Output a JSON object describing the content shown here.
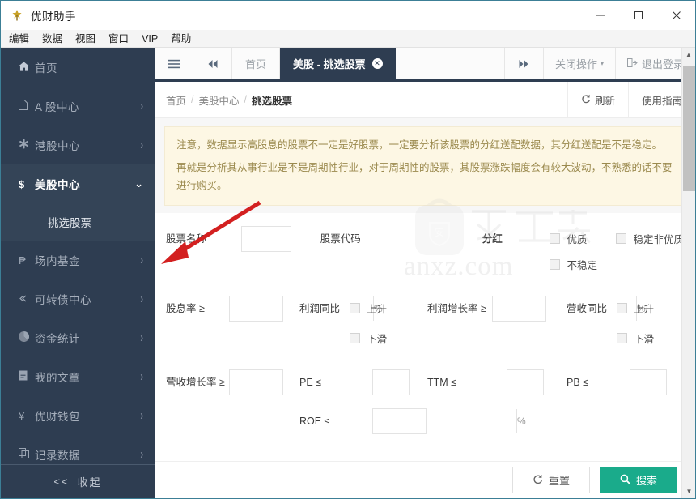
{
  "window": {
    "title": "优财助手",
    "app_icon": "app-logo-icon",
    "controls": {
      "minimize": "−",
      "maximize": "□",
      "close": "✕"
    }
  },
  "menubar": {
    "items": [
      "编辑",
      "数据",
      "视图",
      "窗口",
      "VIP",
      "帮助"
    ]
  },
  "sidebar": {
    "items": [
      {
        "label": "首页",
        "icon": "home-icon",
        "chevron": "",
        "active": false
      },
      {
        "label": "A 股中心",
        "icon": "file-icon",
        "chevron": "›",
        "active": false
      },
      {
        "label": "港股中心",
        "icon": "asterisk-icon",
        "chevron": "›",
        "active": false
      },
      {
        "label": "美股中心",
        "icon": "dollar-icon",
        "chevron": "⌄",
        "active": true
      },
      {
        "label": "场内基金",
        "icon": "peso-icon",
        "chevron": "›",
        "active": false
      },
      {
        "label": "可转债中心",
        "icon": "link-icon",
        "chevron": "›",
        "active": false
      },
      {
        "label": "资金统计",
        "icon": "pie-chart-icon",
        "chevron": "›",
        "active": false
      },
      {
        "label": "我的文章",
        "icon": "document-icon",
        "chevron": "›",
        "active": false
      },
      {
        "label": "优财钱包",
        "icon": "yen-icon",
        "chevron": "›",
        "active": false
      },
      {
        "label": "记录数据",
        "icon": "copy-icon",
        "chevron": "›",
        "active": false
      }
    ],
    "submenu": {
      "label": "挑选股票",
      "selected": true
    },
    "collapse": {
      "arrows": "<<",
      "label": "收起"
    }
  },
  "tabstrip": {
    "menu_icon": "hamburger-icon",
    "prev_icon": "double-chevron-left-icon",
    "next_icon": "double-chevron-right-icon",
    "tabs": [
      {
        "label": "首页",
        "active": false,
        "closable": false
      },
      {
        "label": "美股 - 挑选股票",
        "active": true,
        "closable": true
      }
    ],
    "close_ops": {
      "label": "关闭操作",
      "caret": "▾"
    },
    "logout": {
      "label": "退出登录",
      "icon": "logout-icon"
    }
  },
  "breadcrumb": {
    "items": [
      "首页",
      "美股中心",
      "挑选股票"
    ],
    "separator": "/",
    "refresh": {
      "label": "刷新",
      "icon": "refresh-icon"
    },
    "guide": {
      "label": "使用指南"
    }
  },
  "notice": {
    "line1": "注意，数据显示高股息的股票不一定是好股票，一定要分析该股票的分红送配数据，其分红送配是不是稳定。",
    "line2": "再就是分析其从事行业是不是周期性行业，对于周期性的股票，其股票涨跌幅度会有较大波动，不熟悉的话不要进行购买。",
    "bg_color": "#fdf7e4",
    "text_color": "#9b8a4e"
  },
  "watermark": {
    "text": "anxz.com",
    "logo": "shield-bag-logo"
  },
  "form": {
    "row1": {
      "stock_name": {
        "label": "股票名称",
        "value": "",
        "placeholder": ""
      },
      "stock_code": {
        "label": "股票代码",
        "value": "",
        "placeholder": ""
      },
      "dividend": {
        "label": "分红"
      },
      "checkboxes": [
        {
          "label": "优质",
          "checked": false
        },
        {
          "label": "稳定非优质",
          "checked": false
        },
        {
          "label": "不稳定",
          "checked": false
        }
      ]
    },
    "row2": {
      "dividend_rate": {
        "label": "股息率 ≥",
        "value": "",
        "suffix": "%"
      },
      "profit_yoy": {
        "label": "利润同比",
        "options": [
          {
            "label": "上升",
            "checked": false
          },
          {
            "label": "下滑",
            "checked": false
          }
        ]
      },
      "profit_growth": {
        "label": "利润增长率 ≥",
        "value": "",
        "suffix": "%"
      },
      "revenue_yoy": {
        "label": "营收同比",
        "options": [
          {
            "label": "上升",
            "checked": false
          },
          {
            "label": "下滑",
            "checked": false
          }
        ]
      }
    },
    "row3": {
      "revenue_growth": {
        "label": "营收增长率 ≥",
        "value": "",
        "suffix": "%"
      },
      "pe": {
        "label": "PE ≤",
        "value": ""
      },
      "ttm": {
        "label": "TTM ≤",
        "value": ""
      },
      "pb": {
        "label": "PB ≤",
        "value": ""
      },
      "roe": {
        "label": "ROE ≤",
        "value": "",
        "suffix": "%"
      }
    }
  },
  "footer": {
    "reset": {
      "label": "重置",
      "icon": "refresh-icon"
    },
    "search": {
      "label": "搜索",
      "icon": "search-icon",
      "color": "#1aab8b"
    }
  },
  "scrollbar": {
    "up": "▲",
    "down": "▼"
  }
}
